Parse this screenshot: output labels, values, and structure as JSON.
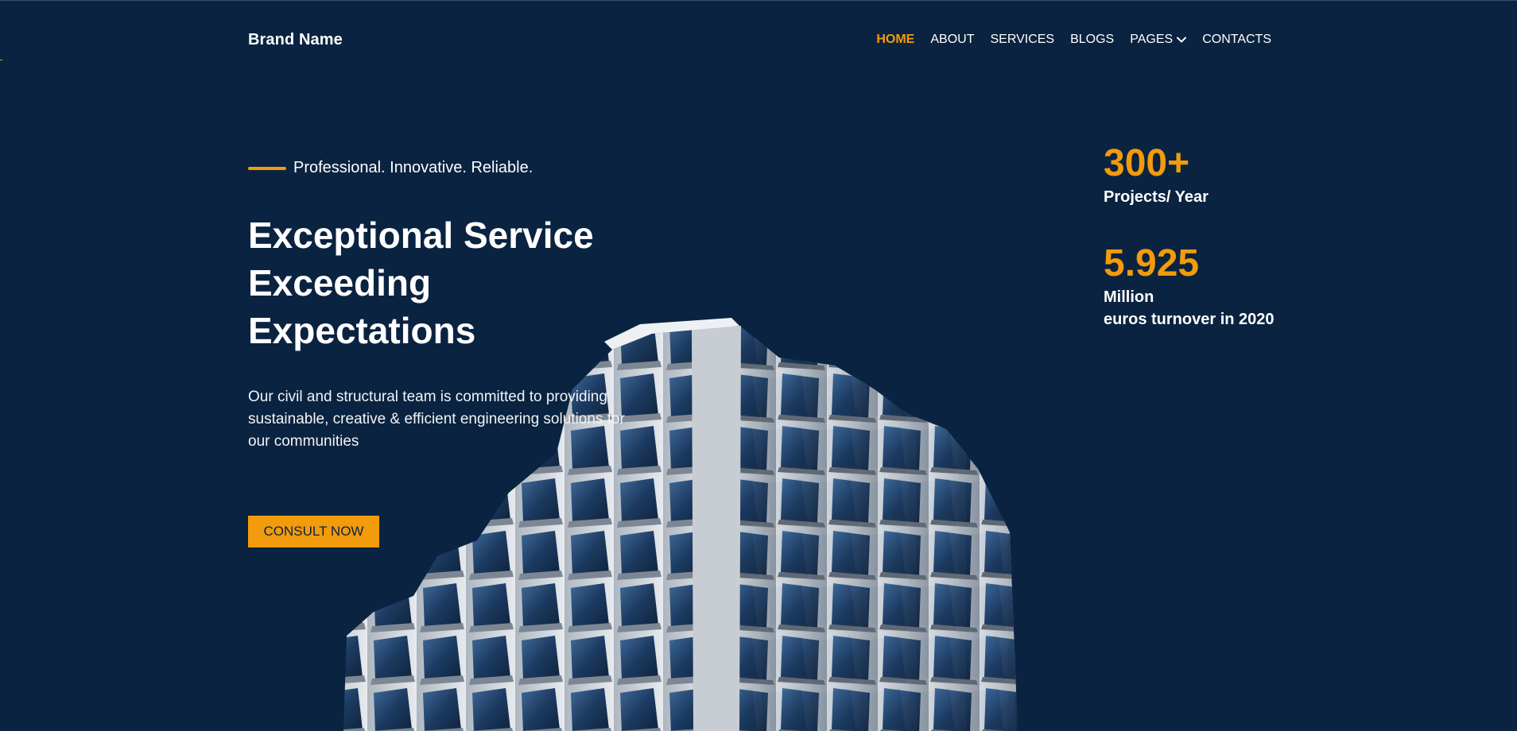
{
  "brand": {
    "name": "Brand Name"
  },
  "nav": {
    "items": [
      "HOME",
      "ABOUT",
      "SERVICES",
      "BLOGS",
      "PAGES",
      "CONTACTS"
    ],
    "active": "HOME",
    "dropdown_icon": "chevron-down-icon"
  },
  "hero": {
    "tagline": "Professional. Innovative. Reliable.",
    "headline": [
      "Exceptional Service",
      "Exceeding",
      "Expectations"
    ],
    "description": "Our civil and structural team is committed to providing sustainable, creative & efficient engineering solutions for our communities",
    "cta_label": "CONSULT NOW"
  },
  "stats": [
    {
      "value": "300+",
      "label_lines": [
        "Projects/ Year"
      ]
    },
    {
      "value": "5.925",
      "label_lines": [
        "Million",
        "euros turnover in 2020"
      ]
    }
  ],
  "colors": {
    "background": "#0a2340",
    "accent": "#f29b0c",
    "text": "#ffffff"
  },
  "image": {
    "subject": "modern-building-photo"
  }
}
